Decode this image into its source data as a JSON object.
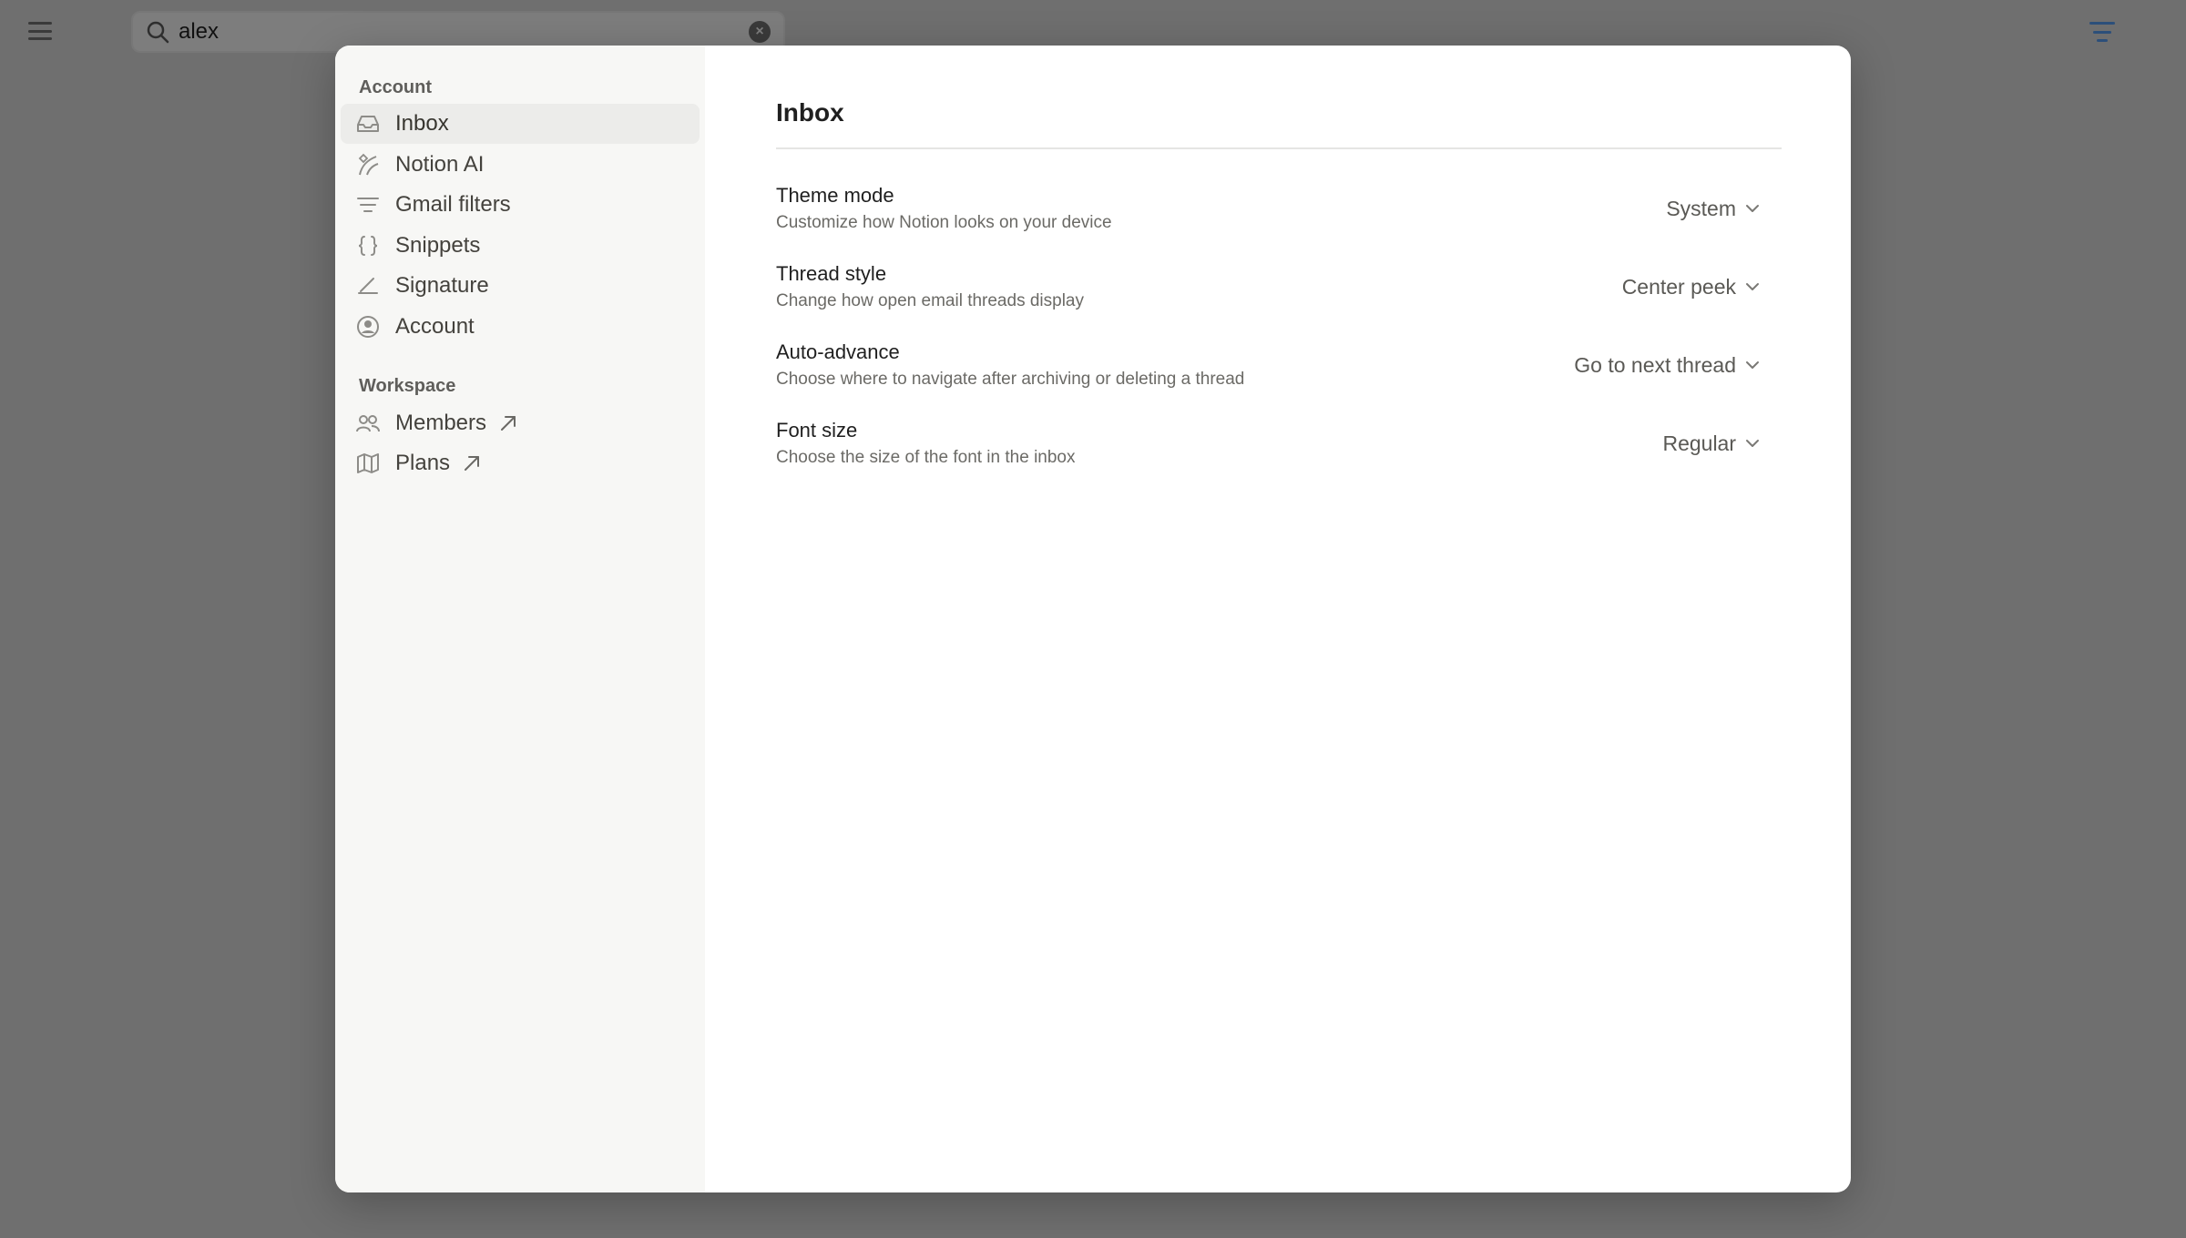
{
  "search": {
    "value": "alex",
    "placeholder": ""
  },
  "sidebar": {
    "account_label": "Account",
    "account_items": [
      {
        "label": "Inbox",
        "icon": "inbox-icon"
      },
      {
        "label": "Notion AI",
        "icon": "notion-ai-icon"
      },
      {
        "label": "Gmail filters",
        "icon": "filter-lines-icon"
      },
      {
        "label": "Snippets",
        "icon": "braces-icon"
      },
      {
        "label": "Signature",
        "icon": "signature-icon"
      },
      {
        "label": "Account",
        "icon": "user-circle-icon"
      }
    ],
    "workspace_label": "Workspace",
    "workspace_items": [
      {
        "label": "Members",
        "icon": "people-icon"
      },
      {
        "label": "Plans",
        "icon": "map-icon"
      }
    ]
  },
  "content": {
    "title": "Inbox",
    "settings": [
      {
        "title": "Theme mode",
        "description": "Customize how Notion looks on your device",
        "value": "System"
      },
      {
        "title": "Thread style",
        "description": "Change how open email threads display",
        "value": "Center peek"
      },
      {
        "title": "Auto-advance",
        "description": "Choose where to navigate after archiving or deleting a thread",
        "value": "Go to next thread"
      },
      {
        "title": "Font size",
        "description": "Choose the size of the font in the inbox",
        "value": "Regular"
      }
    ]
  },
  "colors": {
    "overlay": "#6f6f6f",
    "sidebar_bg": "#f7f7f5",
    "active_item_bg": "#ececea",
    "filter_accent": "#2c4f7a"
  }
}
